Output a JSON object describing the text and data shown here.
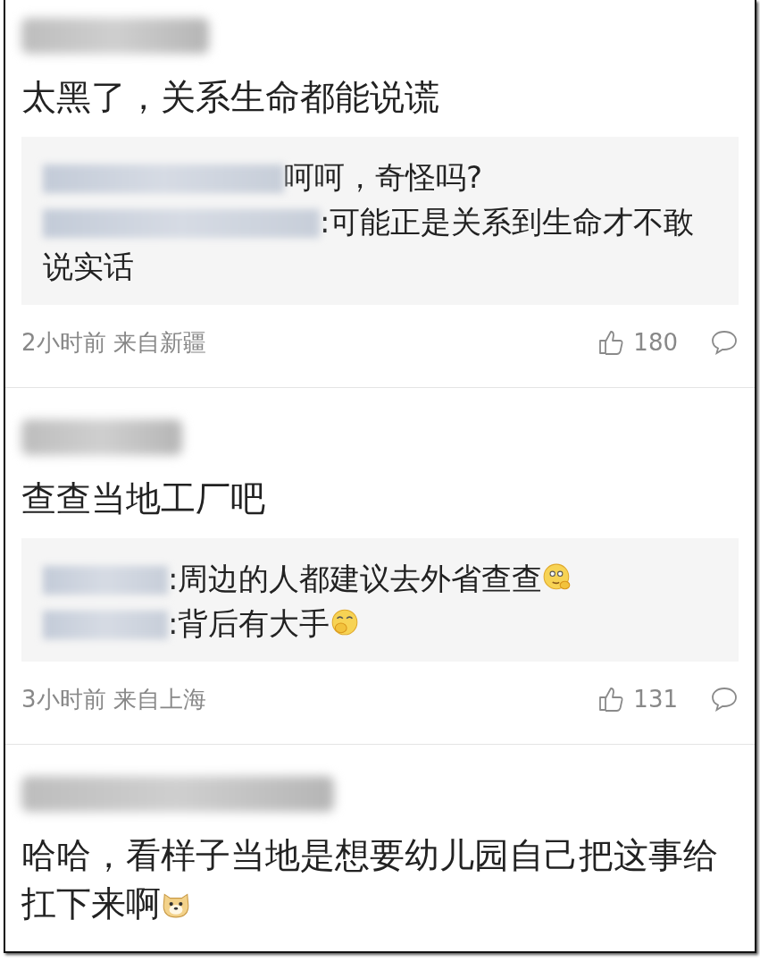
{
  "comments": [
    {
      "text": "太黑了，关系生命都能说谎",
      "replies": [
        {
          "text": "呵呵，奇怪吗?"
        },
        {
          "text": ":可能正是关系到生命才不敢说实话"
        }
      ],
      "time": "2小时前",
      "location": "来自新疆",
      "likes": "180"
    },
    {
      "text": "查查当地工厂吧",
      "replies": [
        {
          "text": ":周边的人都建议去外省查查",
          "emoji": {
            "kind": "thinking"
          }
        },
        {
          "text": ":背后有大手",
          "emoji": {
            "kind": "snicker"
          }
        }
      ],
      "time": "3小时前",
      "location": "来自上海",
      "likes": "131"
    },
    {
      "text": "哈哈，看样子当地是想要幼儿园自己把这事给扛下来啊",
      "emoji": {
        "kind": "dog"
      }
    }
  ]
}
